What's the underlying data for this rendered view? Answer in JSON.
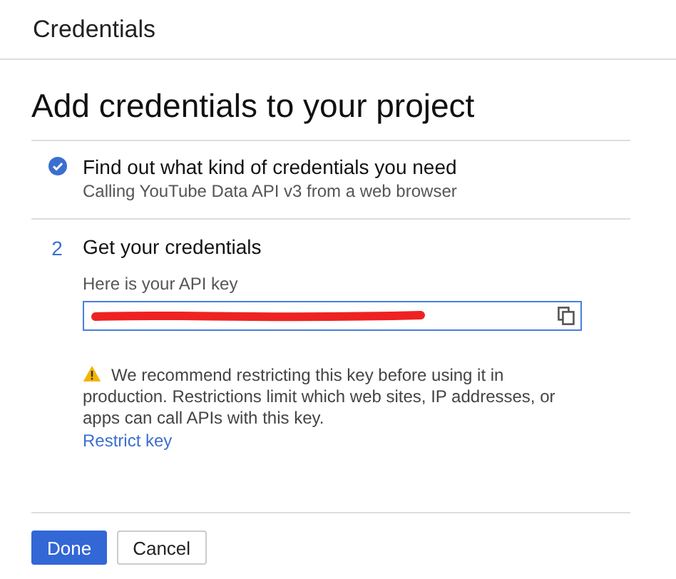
{
  "header": {
    "title": "Credentials"
  },
  "page_title": "Add credentials to your project",
  "steps": [
    {
      "completed": true,
      "title": "Find out what kind of credentials you need",
      "subtitle": "Calling YouTube Data API v3 from a web browser"
    },
    {
      "completed": false,
      "number": "2",
      "title": "Get your credentials",
      "field_label": "Here is your API key",
      "field_redacted": true,
      "warning": "We recommend restricting this key before using it in production. Restrictions limit which web sites, IP addresses, or apps can call APIs with this key.",
      "link": "Restrict key"
    }
  ],
  "buttons": [
    {
      "label": "Done",
      "primary": true
    },
    {
      "label": "Cancel",
      "primary": false
    }
  ]
}
